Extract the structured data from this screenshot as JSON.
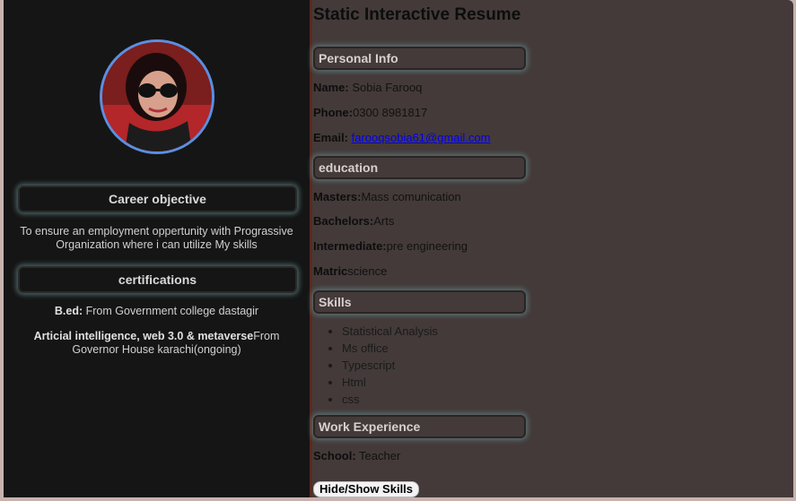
{
  "sidebar": {
    "career_heading": "Career objective",
    "career_text": "To ensure an employment oppertunity with Prograssive Organization where i can utilize My skills",
    "cert_heading": "certifications",
    "certs": [
      {
        "title": "B.ed:",
        "desc": " From Government college dastagir"
      },
      {
        "title": "Articial intelligence, web 3.0 & metaverse",
        "desc": "From Governor House karachi(ongoing)"
      }
    ]
  },
  "main": {
    "title": "Static Interactive Resume",
    "personal_heading": "Personal Info",
    "name_label": "Name:",
    "name_value": " Sobia Farooq",
    "phone_label": "Phone:",
    "phone_value": "0300 8981817",
    "email_label": "Email:",
    "email_value": "farooqsobia61@gmail.com",
    "education_heading": "education",
    "education": [
      {
        "label": "Masters:",
        "value": "Mass comunication"
      },
      {
        "label": "Bachelors:",
        "value": "Arts"
      },
      {
        "label": "Intermediate:",
        "value": "pre engineering"
      },
      {
        "label": "Matric",
        "value": "science"
      }
    ],
    "skills_heading": "Skills",
    "skills": [
      "Statistical Analysis",
      "Ms office",
      "Typescript",
      "Html",
      "css"
    ],
    "work_heading": "Work Experience",
    "work_label": "School:",
    "work_value": " Teacher",
    "toggle_label": "Hide/Show Skills"
  },
  "colors": {
    "sidebar_bg": "#151515",
    "main_bg": "#443a3a",
    "avatar_border": "#5b8fe0",
    "link": "#0000ee"
  }
}
